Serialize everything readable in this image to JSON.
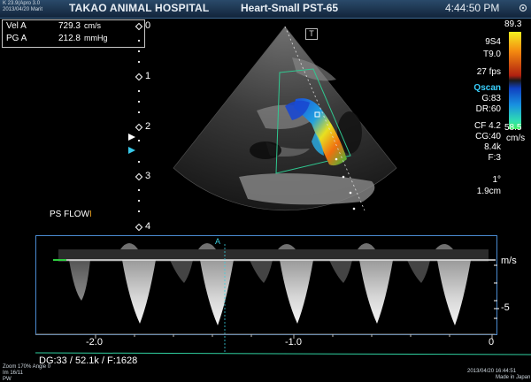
{
  "header": {
    "top_left_line1": "K 23.9(Apro 3.0",
    "top_left_line2": "2013/04/20 Marit",
    "hospital": "TAKAO ANIMAL HOSPITAL",
    "preset": "Heart-Small PST-65",
    "clock": "4:44:50 PM"
  },
  "measurements": [
    {
      "label": "Vel  A",
      "value": "729.3",
      "unit": "cm/s"
    },
    {
      "label": "PG  A",
      "value": "212.8",
      "unit": "mmHg"
    }
  ],
  "depth_ticks": [
    "0",
    "1",
    "2",
    "3",
    "4"
  ],
  "right_panel": {
    "probe": "9S4",
    "tissue": "T9.0",
    "fps": "27 fps",
    "qscan": "Qscan",
    "gain": "G:83",
    "dr": "DR:60",
    "cf": "CF 4.2",
    "cg": "CG:40",
    "prf": "8.4k",
    "filter": "F:3",
    "angle": "1°",
    "depth": "1.9cm"
  },
  "colorbar": {
    "top": "89.3",
    "bottom": "58.5",
    "unit": "cm/s"
  },
  "image_marker": "T",
  "doppler": {
    "label": "PS FLOW",
    "unit": "m/s",
    "y_tick_minus5": "-5",
    "sample_marker": "A",
    "time_ticks": [
      "-2.0",
      "-1.0",
      "0"
    ]
  },
  "footer": {
    "dg": "DG:33  / 52.1k  / F:1628",
    "zoom": "Zoom  170%  Angle  0",
    "frames": "Im  16/11",
    "mode": "PW",
    "datetime": "2013/04/20 16:44:51",
    "made_in": "Made in Japan"
  },
  "colors": {
    "panel_border": "#4a8ad0",
    "baseline_green": "#2ecc40",
    "ecg": "#30d0a0"
  }
}
